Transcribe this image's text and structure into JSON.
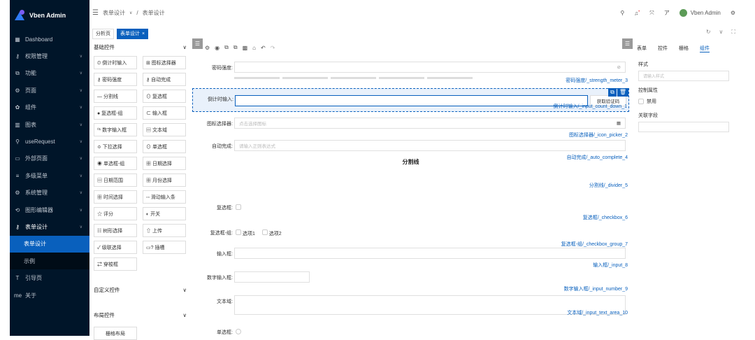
{
  "app": {
    "title": "Vben Admin"
  },
  "sidebar": {
    "items": [
      {
        "icon": "▦",
        "label": "Dashboard"
      },
      {
        "icon": "⚷",
        "label": "权限管理"
      },
      {
        "icon": "⧉",
        "label": "功能"
      },
      {
        "icon": "⚙",
        "label": "页面"
      },
      {
        "icon": "✿",
        "label": "组件"
      },
      {
        "icon": "▥",
        "label": "图表"
      },
      {
        "icon": "⚲",
        "label": "useRequest"
      },
      {
        "icon": "▭",
        "label": "外部页面"
      },
      {
        "icon": "≡",
        "label": "多级菜单"
      },
      {
        "icon": "⚙",
        "label": "系统管理"
      },
      {
        "icon": "⟲",
        "label": "图形编辑器"
      },
      {
        "icon": "⚷",
        "label": "表单设计"
      }
    ],
    "sub_items": [
      "表单设计",
      "示例"
    ],
    "bottom_items": [
      {
        "icon": "T",
        "label": "引导页"
      },
      {
        "icon": "me",
        "label": "关于"
      }
    ]
  },
  "header": {
    "breadcrumb": [
      "表单设计",
      "表单设计"
    ],
    "user": "Vben Admin"
  },
  "tabs": [
    "分析页",
    "表单设计"
  ],
  "left_panel": {
    "basic_title": "基础控件",
    "components": [
      [
        "⏲ 倒计时输入",
        "⊞ 图标选择器"
      ],
      [
        "⚷ 密码强度",
        "⚷ 自动完成"
      ],
      [
        "— 分割线",
        "⊙ 复选框"
      ],
      [
        "● 复选框-组",
        "⊂ 输入框"
      ],
      [
        "⁰¹ 数字输入框",
        "▤ 文本域"
      ],
      [
        "≎ 下拉选择",
        "⊙ 单选框"
      ],
      [
        "◉ 单选框-组",
        "▦ 日期选择"
      ],
      [
        "▤ 日期范围",
        "▦ 月份选择"
      ],
      [
        "▦ 时间选择",
        "◦◦ 滑动输入条"
      ],
      [
        "☆ 评分",
        "◐ 开关"
      ],
      [
        "☷ 树形选择",
        "⇧ 上传"
      ],
      [
        "✓ 级联选择",
        "▭? 插槽"
      ],
      [
        "⇄ 穿梭框",
        ""
      ]
    ],
    "custom_title": "自定义控件",
    "layout_title": "布局控件",
    "grid_button": "栅格布局"
  },
  "canvas": {
    "rows": [
      {
        "label": "密码强度:",
        "tag": "密码强度/_strength_meter_3"
      },
      {
        "label": "倒计时输入:",
        "tag": "倒计时输入/_input_count_down_1",
        "button": "获取验证码"
      },
      {
        "label": "图标选择器:",
        "placeholder": "点击选择图标",
        "tag": "图标选择器/_icon_picker_2"
      },
      {
        "label": "自动完成:",
        "placeholder": "请输入正则表达式",
        "tag": "自动完成/_auto_complete_4"
      },
      {
        "divider": "分割线",
        "tag": "分割线/_divider_5"
      },
      {
        "label": "复选框:",
        "tag": "复选框/_checkbox_6"
      },
      {
        "label": "复选框-组:",
        "options": [
          "选项1",
          "选项2"
        ],
        "tag": "复选框-组/_checkbox_group_7"
      },
      {
        "label": "输入框:",
        "tag": "输入框/_input_8"
      },
      {
        "label": "数字输入框:",
        "tag": "数字输入框/_input_number_9"
      },
      {
        "label": "文本域:",
        "tag": "文本域/_input_text_area_10"
      },
      {
        "label": "单选框:"
      }
    ]
  },
  "right_panel": {
    "tabs": [
      "表单",
      "控件",
      "栅格",
      "组件"
    ],
    "style_label": "样式",
    "style_placeholder": "请输入样式",
    "control_label": "控制属性",
    "disabled_label": "禁用",
    "linked_label": "关联字段"
  }
}
